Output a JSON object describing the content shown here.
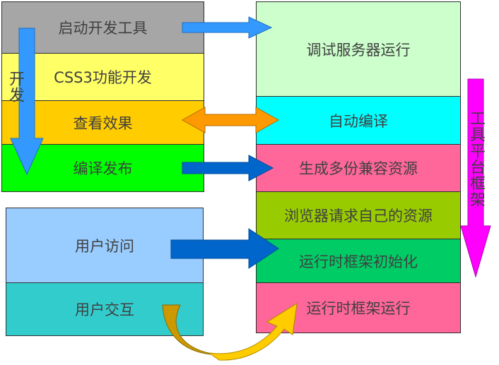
{
  "dev_stack": {
    "items": [
      {
        "label": "启动开发工具",
        "color": "#a6a6a6"
      },
      {
        "label": "CSS3功能开发",
        "color": "#ffff66"
      },
      {
        "label": "查看效果",
        "color": "#ffcc00"
      },
      {
        "label": "编译发布",
        "color": "#00ff00"
      }
    ],
    "side_label": "开发"
  },
  "tool_stack": {
    "items": [
      {
        "label": "调试服务器运行",
        "color": "#ccffcc"
      },
      {
        "label": "自动编译",
        "color": "#00ffff"
      },
      {
        "label": "生成多份兼容资源",
        "color": "#ff6699"
      },
      {
        "label": "浏览器请求自己的资源",
        "color": "#99cc00"
      },
      {
        "label": "运行时框架初始化",
        "color": "#00cc66"
      },
      {
        "label": "运行时框架运行",
        "color": "#ff6699"
      }
    ],
    "side_label": "工具平台框架"
  },
  "user_stack": {
    "items": [
      {
        "label": "用户访问",
        "color": "#99ccff"
      },
      {
        "label": "用户交互",
        "color": "#33cccc"
      }
    ]
  },
  "colors": {
    "arrow_light_blue": "#3399ff",
    "arrow_dark_blue": "#0066cc",
    "arrow_orange": "#ff9900",
    "arrow_magenta": "#ff00ff",
    "curve_dark": "#cc9900",
    "curve_light": "#ffcc00"
  }
}
